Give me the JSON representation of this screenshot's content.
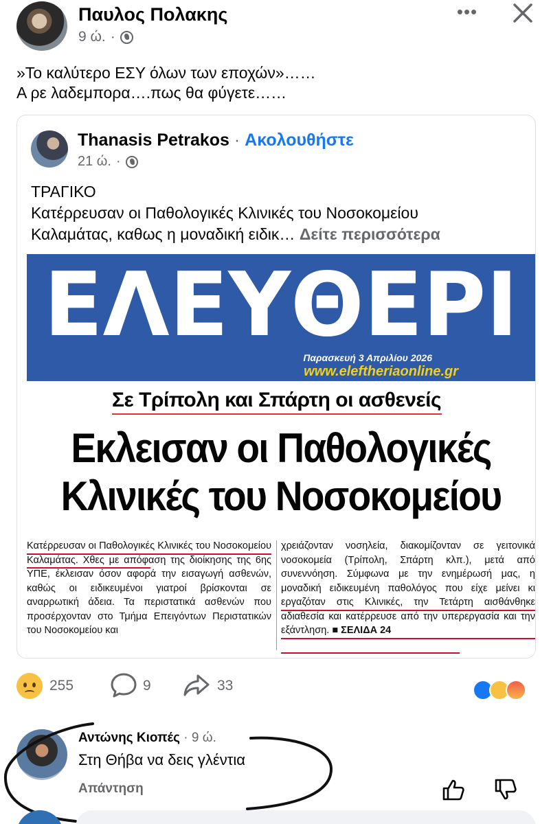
{
  "post": {
    "author": "Παυλος Πολακης",
    "time": "9 ώ.",
    "separator": "·",
    "text_line1": "»Το καλύτερο ΕΣΥ όλων των εποχών»……",
    "text_line2": "Α ρε λαδεμπορα….πως θα φύγετε……"
  },
  "shared": {
    "author": "Thanasis Petrakos",
    "dot": " · ",
    "follow": "Ακολουθήστε",
    "time": "21 ώ.",
    "separator": "·",
    "text_line1": "ΤΡΑΓΙΚΟ",
    "text_line2": "Κατέρρευσαν οι Παθολογικές Κλινικές του Νοσοκομείου",
    "text_line3": "Καλαμάτας, καθως η  μοναδική ειδικ… ",
    "see_more": "Δείτε περισσότερα"
  },
  "newspaper": {
    "masthead": "ΕΛΕΥΘΕΡΙ",
    "date": "Παρασκευή 3 Απριλίου 2026",
    "website": "www.eleftheriaonline.gr",
    "kicker": "Σε Τρίπολη και Σπάρτη οι ασθενείς",
    "headline_line1": "Εκλεισαν οι Παθολογικές",
    "headline_line2": "Κλινικές του Νοσοκομείου",
    "col_left": "Κατέρρευσαν οι Παθολογικές Κλινικές του Νοσοκομείου Καλαμάτας. Χθες με απόφαση της διοίκησης της 6ης ΥΠΕ, έκλεισαν όσον αφορά την εισαγωγή ασθενών, καθώς οι ειδικευμένοι γιατροί βρίσκονται σε αναρρωτική άδεια. Τα περιστατικά ασθενών που προσέρχονταν στο Τμήμα Επειγόντων Περιστατικών του Νοσοκομείου και",
    "col_right": "χρειάζονταν νοσηλεία, διακομίζονταν σε γειτονικά νοσοκομεία (Τρίπολη, Σπάρτη κλπ.), μετά από συνεννόηση. Σύμφωνα με την ενημέρωσή μας, η μοναδική ειδικευμένη παθολόγος που είχε μείνει κι εργαζόταν στις Κλινικές, την Τετάρτη αισθάνθηκε αδιαθεσία και κατέρρευσε από την υπερεργασία και την εξάντληση.",
    "page_ref": "■ ΣΕΛΙΔΑ 24"
  },
  "reactions": {
    "reaction_count": "255",
    "comment_count": "9",
    "share_count": "33"
  },
  "comment": {
    "author": "Αντώνης Κιοπές",
    "time": " · 9 ώ.",
    "text": "Στη Θήβα να δεις γλέντια",
    "reply": "Απάντηση"
  },
  "colors": {
    "accent": "#1877f2",
    "masthead_blue": "#2e5aa8",
    "website_yellow": "#f0d01c",
    "underline_red": "#c8102e"
  },
  "icons": [
    "globe-icon",
    "more-icon",
    "close-icon",
    "sad-emoji-icon",
    "comment-icon",
    "share-icon",
    "like-reaction-icon",
    "sad-reaction-icon",
    "angry-reaction-icon",
    "thumb-up-icon",
    "thumb-down-icon"
  ]
}
